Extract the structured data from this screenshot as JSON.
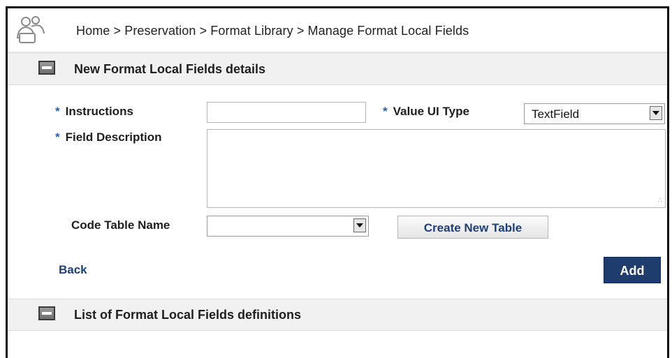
{
  "header": {
    "breadcrumb": "Home > Preservation > Format Library > Manage Format Local Fields",
    "icon": "users-icon"
  },
  "new_section": {
    "title": "New Format Local Fields details",
    "icon": "collapse-icon",
    "form": {
      "required_marker": "*",
      "instructions_label": "Instructions",
      "instructions_value": "",
      "value_ui_type_label": "Value UI Type",
      "value_ui_type_selected": "TextField",
      "field_description_label": "Field Description",
      "field_description_value": "",
      "code_table_name_label": "Code Table Name",
      "code_table_name_selected": "",
      "create_table_label": "Create New Table",
      "back_label": "Back",
      "add_label": "Add"
    }
  },
  "list_section": {
    "title": "List of Format Local Fields definitions",
    "icon": "collapse-icon"
  },
  "colors": {
    "accent": "#1f3c6e",
    "link": "#1d3f7a",
    "required": "#2a5db0",
    "section_bg": "#f1f1f1"
  }
}
